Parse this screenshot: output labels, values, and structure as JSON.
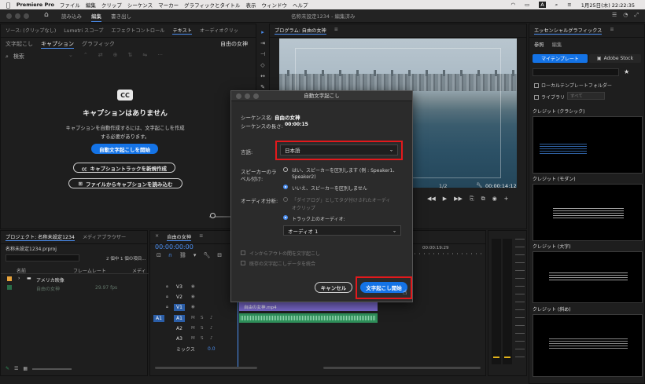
{
  "menubar": {
    "apple": "",
    "app_name": "Premiere Pro",
    "items": [
      "ファイル",
      "編集",
      "クリップ",
      "シーケンス",
      "マーカー",
      "グラフィックとタイトル",
      "表示",
      "ウィンドウ",
      "ヘルプ"
    ],
    "status_a": "A",
    "datetime": "1月25日(木)  22:22:35"
  },
  "window": {
    "title": "名称未設定1234 - 編集済み",
    "workspaces": [
      "読み込み",
      "編集",
      "書き出し"
    ]
  },
  "source_panel": {
    "tabs": [
      "ソース: (クリップなし)",
      "Lumetri スコープ",
      "エフェクトコントロール",
      "テキスト",
      "オーディオクリッ"
    ],
    "sub_tabs": [
      "文字起こし",
      "キャプション",
      "グラフィック"
    ],
    "sequence_name": "自由の女神",
    "search_label": "検索",
    "cc_glyph": "CC",
    "empty_title": "キャプションはありません",
    "empty_desc_1": "キャプションを自動作成するには、文字起こしを作成",
    "empty_desc_2": "する必要があります。",
    "btn_auto": "自動文字起こしを開始",
    "btn_new_track": "キャプショントラックを新規作成",
    "btn_import": "ファイルからキャプションを読み込む"
  },
  "program": {
    "tab": "プログラム: 自由の女神",
    "fraction": "1/2",
    "timecode": "00:00:14:12"
  },
  "essential": {
    "title": "エッセンシャルグラフィックス",
    "tabs": [
      "参照",
      "編集"
    ],
    "btn_my_templates": "マイテンプレート",
    "btn_adobe_stock": "Adobe Stock",
    "local_folder": "ローカルテンプレートフォルダー",
    "library": "ライブラリ",
    "library_select": "すべて",
    "credits": [
      "クレジット (クラシック)",
      "クレジット (モダン)",
      "クレジット (大字)",
      "クレジット (斜め)"
    ]
  },
  "project": {
    "tabs": [
      "プロジェクト: 名称未設定1234",
      "メディアブラウザー"
    ],
    "file": "名称未設定1234.prproj",
    "selection": "2 個中 1 個の項目...",
    "col_name": "名前",
    "col_fps": "フレームレート",
    "col_media": "メディ",
    "row_folder": "アメリカ映像",
    "row_clip": "自由の女神",
    "row_clip_fps": "29.97 fps"
  },
  "timeline": {
    "tab": "自由の女神",
    "timecode": "00:00:00:00",
    "ruler": "00:00:19:29",
    "tracks": [
      "V3",
      "V2",
      "V1",
      "A1",
      "A2",
      "A3"
    ],
    "src_target": "A1",
    "mix_label": "ミックス",
    "mix_val": "0.0",
    "clip_label": "自由の女神.mp4"
  },
  "dialog": {
    "title": "自動文字起こし",
    "seq_name_label": "シーケンス名:",
    "seq_name": "自由の女神",
    "seq_len_label": "シーケンスの長さ:",
    "seq_len": "00:00:15",
    "lang_label": "言語:",
    "lang_value": "日本語",
    "speaker_label_1": "スピーカーのラ",
    "speaker_label_2": "ベル付け:",
    "speaker_opt1_1": "はい、スピーカーを区別します (例 : Speaker1、",
    "speaker_opt1_2": "Speaker2)",
    "speaker_opt2": "いいえ、スピーカーを区別しません",
    "audio_label": "オーディオ分析:",
    "audio_opt1_1": "「ダイアログ」としてタグ付けされたオーディ",
    "audio_opt1_2": "オクリップ",
    "audio_opt2": "トラック上のオーディオ:",
    "audio_track": "オーディオ 1",
    "chk_inout": "インからアウトの間を文字起こし",
    "chk_merge": "既存の文字起こしデータを統合",
    "btn_cancel": "キャンセル",
    "btn_start": "文字起こし開始"
  },
  "colors": {
    "accent_blue": "#1473e6",
    "highlight_red": "#e3191c",
    "clip_purple": "#7d6bd1",
    "audio_green": "#2f8f5a"
  }
}
